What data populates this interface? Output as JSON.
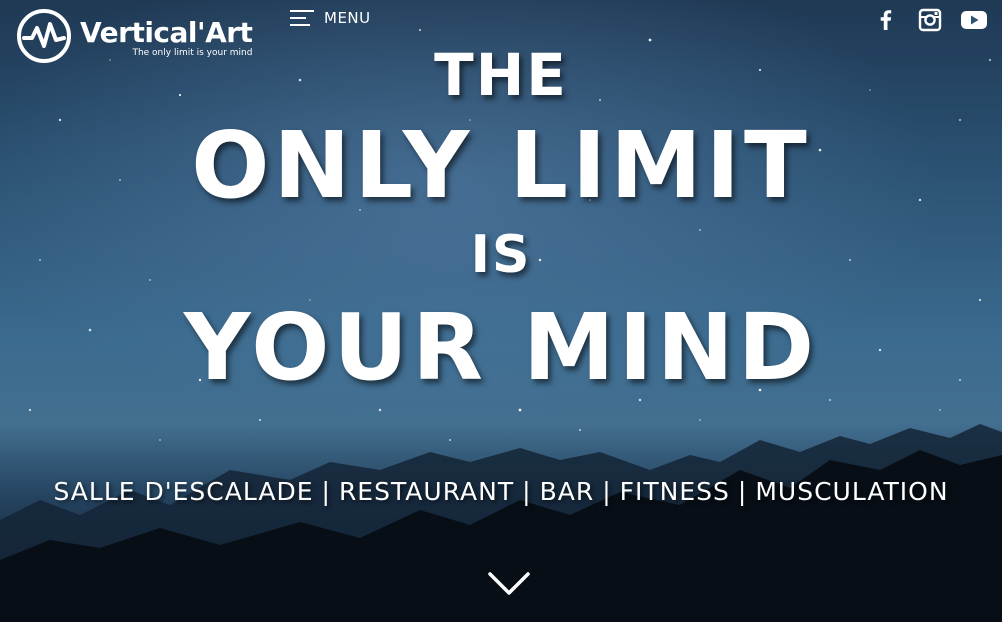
{
  "logo": {
    "name": "Vertical'Art",
    "tagline": "The only limit is your mind",
    "icon": "mountain-pulse-logo-icon"
  },
  "nav": {
    "menu_label": "MENU",
    "menu_icon": "hamburger-icon"
  },
  "social": [
    {
      "name": "facebook",
      "icon": "facebook-icon"
    },
    {
      "name": "instagram",
      "icon": "instagram-icon"
    },
    {
      "name": "youtube",
      "icon": "youtube-icon"
    }
  ],
  "hero": {
    "line1": "THE",
    "line2": "ONLY LIMIT",
    "line3": "IS",
    "line4": "YOUR MIND"
  },
  "services": [
    "SALLE D'ESCALADE",
    "RESTAURANT",
    "BAR",
    "FITNESS",
    "MUSCULATION"
  ],
  "services_separator": "|",
  "scroll": {
    "icon": "chevron-down-icon"
  },
  "colors": {
    "text": "#ffffff",
    "sky_top": "#1f3954",
    "sky_mid": "#3b6b8f",
    "mountain": "#0d1a28"
  }
}
